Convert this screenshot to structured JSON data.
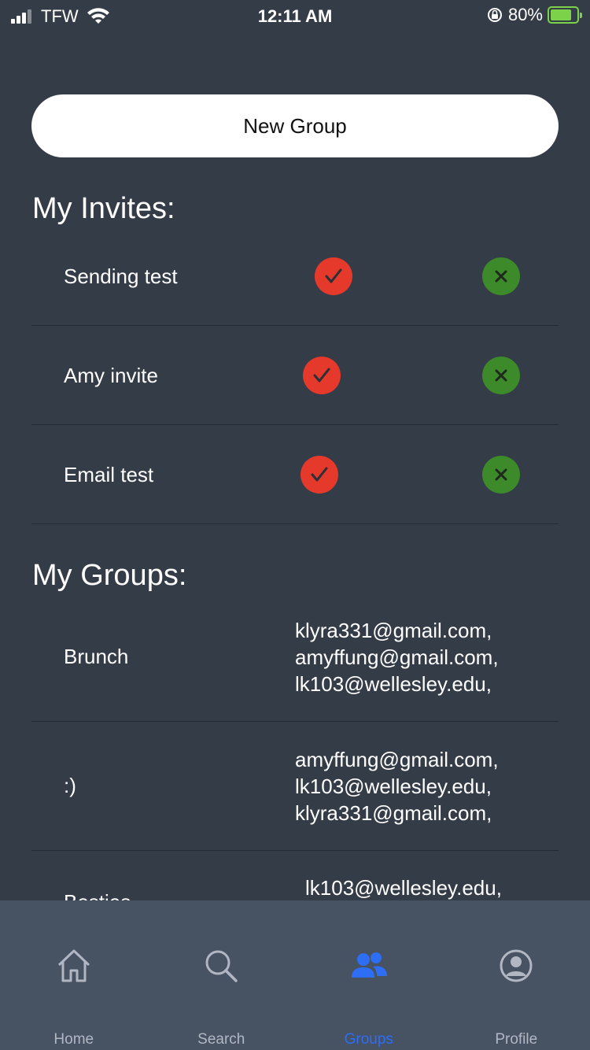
{
  "status_bar": {
    "carrier": "TFW",
    "time": "12:11 AM",
    "battery": "80%"
  },
  "new_group_label": "New Group",
  "invites": {
    "title": "My Invites:",
    "items": [
      {
        "name": "Sending test"
      },
      {
        "name": "Amy invite"
      },
      {
        "name": "Email test"
      }
    ]
  },
  "groups": {
    "title": "My Groups:",
    "items": [
      {
        "name": "Brunch",
        "members": [
          "klyra331@gmail.com,",
          "amyffung@gmail.com,",
          "lk103@wellesley.edu,"
        ]
      },
      {
        "name": ":)",
        "members": [
          "amyffung@gmail.com,",
          "lk103@wellesley.edu,",
          "klyra331@gmail.com,"
        ]
      },
      {
        "name": "Besties",
        "members": [
          "lk103@wellesley.edu,"
        ]
      }
    ]
  },
  "tabs": [
    {
      "label": "Home",
      "icon": "home-icon"
    },
    {
      "label": "Search",
      "icon": "search-icon"
    },
    {
      "label": "Groups",
      "icon": "groups-icon",
      "active": true
    },
    {
      "label": "Profile",
      "icon": "profile-icon"
    }
  ],
  "colors": {
    "background": "#343c48",
    "accept": "#e5392b",
    "decline": "#3d8a2a",
    "tab_active": "#2d6ef5",
    "tab_bar": "#475263"
  }
}
